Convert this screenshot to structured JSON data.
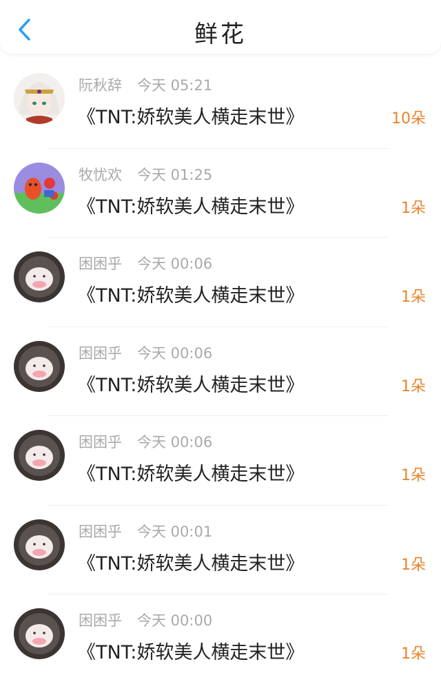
{
  "header": {
    "title": "鲜花",
    "back_icon": "chevron-left-icon"
  },
  "colors": {
    "accent": "#2a9df4",
    "count": "#e8842a",
    "meta": "#a9a9a9"
  },
  "items": [
    {
      "name": "阮秋辞",
      "time": "今天 05:21",
      "book": "《TNT:娇软美人横走末世》",
      "count": "10朵"
    },
    {
      "name": "牧忧欢",
      "time": "今天 01:25",
      "book": "《TNT:娇软美人横走末世》",
      "count": "1朵"
    },
    {
      "name": "困困乎",
      "time": "今天 00:06",
      "book": "《TNT:娇软美人横走末世》",
      "count": "1朵"
    },
    {
      "name": "困困乎",
      "time": "今天 00:06",
      "book": "《TNT:娇软美人横走末世》",
      "count": "1朵"
    },
    {
      "name": "困困乎",
      "time": "今天 00:06",
      "book": "《TNT:娇软美人横走末世》",
      "count": "1朵"
    },
    {
      "name": "困困乎",
      "time": "今天 00:01",
      "book": "《TNT:娇软美人横走末世》",
      "count": "1朵"
    },
    {
      "name": "困困乎",
      "time": "今天 00:00",
      "book": "《TNT:娇软美人横走末世》",
      "count": "1朵"
    }
  ]
}
